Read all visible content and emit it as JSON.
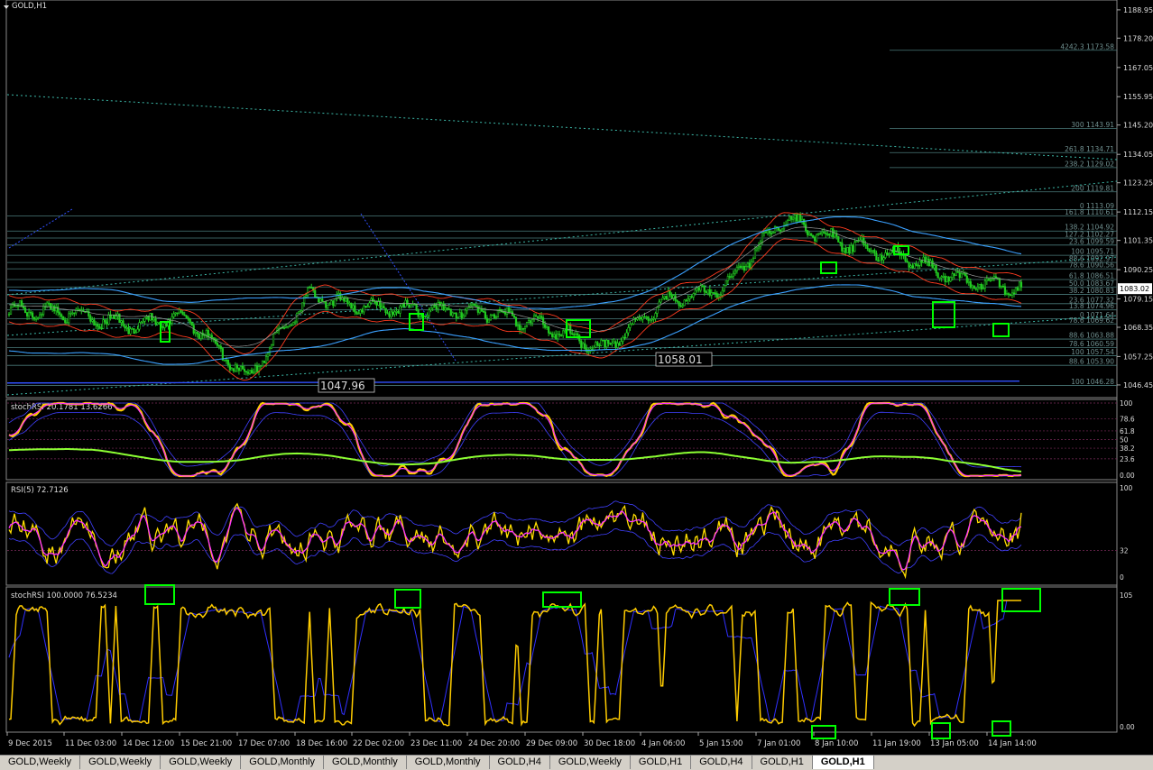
{
  "main_pane": {
    "symbol_title": "GOLD,H1",
    "price_axis_ticks": [
      "1188.95",
      "1178.20",
      "1167.05",
      "1155.95",
      "1145.20",
      "1134.05",
      "1123.25",
      "1112.15",
      "1101.35",
      "1090.25",
      "1079.15",
      "1068.35",
      "1057.25",
      "1046.45"
    ],
    "price_range": [
      1043,
      1192
    ],
    "current_price_label": "1083.02",
    "price_annotations": [
      "1047.96",
      "1058.01"
    ],
    "fib_levels": [
      {
        "label": "4242.3 1173.58",
        "price": 1173.58
      },
      {
        "label": "300 1143.91",
        "price": 1143.91
      },
      {
        "label": "261.8 1134.71",
        "price": 1134.71
      },
      {
        "label": "238.2 1129.02",
        "price": 1129.02
      },
      {
        "label": "200 1119.81",
        "price": 1119.81
      },
      {
        "label": "0 1113.09",
        "price": 1113.09
      },
      {
        "label": "161.8 1110.61",
        "price": 1110.61
      },
      {
        "label": "138.2 1104.92",
        "price": 1104.92
      },
      {
        "label": "127.2 1102.27",
        "price": 1102.27
      },
      {
        "label": "23.6 1099.59",
        "price": 1099.59
      },
      {
        "label": "100 1095.71",
        "price": 1095.71
      },
      {
        "label": "88.6 1092.97",
        "price": 1092.97
      },
      {
        "label": "78.6 1090.56",
        "price": 1090.56
      },
      {
        "label": "61.8 1086.51",
        "price": 1086.51
      },
      {
        "label": "50.0 1083.67",
        "price": 1083.67
      },
      {
        "label": "38.2 1080.83",
        "price": 1080.83
      },
      {
        "label": "23.6 1077.32",
        "price": 1077.32
      },
      {
        "label": "13.8 1074.96",
        "price": 1074.96
      },
      {
        "label": "0 1071.64",
        "price": 1071.64
      },
      {
        "label": "78.6 1069.62",
        "price": 1069.62
      },
      {
        "label": "88.6 1063.88",
        "price": 1063.88
      },
      {
        "label": "78.6 1060.59",
        "price": 1060.59
      },
      {
        "label": "100 1057.54",
        "price": 1057.54
      },
      {
        "label": "88.6 1053.90",
        "price": 1053.9
      },
      {
        "label": "100 1046.28",
        "price": 1046.28
      }
    ]
  },
  "panes": {
    "stoch_rsi_1": {
      "title": "stochRSI 20.1781 13.6266",
      "axis": [
        "100",
        "78.6",
        "61.8",
        "50",
        "38.2",
        "23.6",
        "0",
        "0.00"
      ]
    },
    "rsi": {
      "title": "RSI(5) 72.7126",
      "axis": [
        "100",
        "32",
        "0"
      ]
    },
    "stoch_rsi_2": {
      "title": "stochRSI 100.0000 76.5234",
      "axis": [
        "105",
        "0.00"
      ]
    }
  },
  "time_axis": [
    "9 Dec 2015",
    "11 Dec 03:00",
    "14 Dec 12:00",
    "15 Dec 21:00",
    "17 Dec 07:00",
    "18 Dec 16:00",
    "22 Dec 02:00",
    "23 Dec 11:00",
    "24 Dec 20:00",
    "29 Dec 09:00",
    "30 Dec 18:00",
    "4 Jan 06:00",
    "5 Jan 15:00",
    "7 Jan 01:00",
    "8 Jan 10:00",
    "11 Jan 19:00",
    "13 Jan 05:00",
    "14 Jan 14:00"
  ],
  "tabs": [
    "GOLD,Weekly",
    "GOLD,Weekly",
    "GOLD,Weekly",
    "GOLD,Monthly",
    "GOLD,Monthly",
    "GOLD,Monthly",
    "GOLD,H4",
    "GOLD,Weekly",
    "GOLD,H1",
    "GOLD,H4",
    "GOLD,H1",
    "GOLD,H1"
  ],
  "active_tab_index": 11,
  "colors": {
    "background": "#000000",
    "bull_candle": "#22cc22",
    "bear_candle": "#22cc22",
    "bollinger": "#3aa0ff",
    "envelope_red": "#ff3b1f",
    "fib_line": "#4a7a7a",
    "stoch_main": "#ffcc00",
    "stoch_signal": "#ff33ff",
    "highlight_box": "#00ff00",
    "rsi_line": "#ffdd00",
    "blue_ma": "#4040ff"
  },
  "chart_data": {
    "type": "line",
    "title": "GOLD,H1",
    "x": [
      "9 Dec 2015",
      "11 Dec 03:00",
      "14 Dec 12:00",
      "15 Dec 21:00",
      "17 Dec 07:00",
      "18 Dec 16:00",
      "22 Dec 02:00",
      "23 Dec 11:00",
      "24 Dec 20:00",
      "29 Dec 09:00",
      "30 Dec 18:00",
      "4 Jan 06:00",
      "5 Jan 15:00",
      "7 Jan 01:00",
      "8 Jan 10:00",
      "11 Jan 19:00",
      "13 Jan 05:00",
      "14 Jan 14:00"
    ],
    "series": [
      {
        "values": [
          1075,
          1074,
          1069,
          1072,
          1049,
          1080,
          1076,
          1075,
          1074,
          1069,
          1060,
          1078,
          1083,
          1110,
          1100,
          1095,
          1086,
          1083.02
        ]
      }
    ],
    "ylim": [
      1043,
      1192
    ],
    "annotations": [
      "1047.96",
      "1058.01"
    ]
  }
}
